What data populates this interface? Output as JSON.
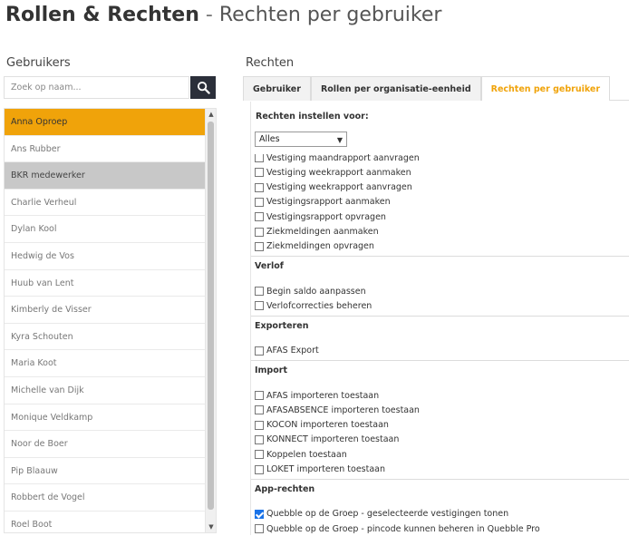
{
  "header": {
    "title_main": "Rollen & Rechten",
    "title_separator": "-",
    "title_sub": "Rechten per gebruiker"
  },
  "users": {
    "heading": "Gebruikers",
    "search_placeholder": "Zoek op naam...",
    "items": [
      {
        "name": "Anna Oproep",
        "state": "selected"
      },
      {
        "name": "Ans Rubber",
        "state": "normal"
      },
      {
        "name": "BKR medewerker",
        "state": "highlight"
      },
      {
        "name": "Charlie Verheul",
        "state": "normal"
      },
      {
        "name": "Dylan Kool",
        "state": "normal"
      },
      {
        "name": "Hedwig de Vos",
        "state": "normal"
      },
      {
        "name": "Huub van Lent",
        "state": "normal"
      },
      {
        "name": "Kimberly de Visser",
        "state": "normal"
      },
      {
        "name": "Kyra Schouten",
        "state": "normal"
      },
      {
        "name": "Maria Koot",
        "state": "normal"
      },
      {
        "name": "Michelle van Dijk",
        "state": "normal"
      },
      {
        "name": "Monique Veldkamp",
        "state": "normal"
      },
      {
        "name": "Noor de Boer",
        "state": "normal"
      },
      {
        "name": "Pip Blaauw",
        "state": "normal"
      },
      {
        "name": "Robbert de Vogel",
        "state": "normal"
      },
      {
        "name": "Roel Boot",
        "state": "normal"
      }
    ]
  },
  "rights": {
    "heading": "Rechten",
    "tabs": [
      {
        "label": "Gebruiker",
        "active": false
      },
      {
        "label": "Rollen per organisatie-eenheid",
        "active": false
      },
      {
        "label": "Rechten per gebruiker",
        "active": true
      }
    ],
    "set_for_label": "Rechten instellen voor:",
    "select_value": "Alles",
    "blocks": [
      {
        "kind": "item",
        "label": "Vestiging maandrapport aanvragen",
        "checked": false,
        "partial": true
      },
      {
        "kind": "item",
        "label": "Vestiging weekrapport aanmaken",
        "checked": false
      },
      {
        "kind": "item",
        "label": "Vestiging weekrapport aanvragen",
        "checked": false
      },
      {
        "kind": "item",
        "label": "Vestigingsrapport aanmaken",
        "checked": false
      },
      {
        "kind": "item",
        "label": "Vestigingsrapport opvragen",
        "checked": false
      },
      {
        "kind": "item",
        "label": "Ziekmeldingen aanmaken",
        "checked": false
      },
      {
        "kind": "item",
        "label": "Ziekmeldingen opvragen",
        "checked": false
      },
      {
        "kind": "section",
        "label": "Verlof"
      },
      {
        "kind": "item",
        "label": "Begin saldo aanpassen",
        "checked": false
      },
      {
        "kind": "item",
        "label": "Verlofcorrecties beheren",
        "checked": false
      },
      {
        "kind": "section",
        "label": "Exporteren"
      },
      {
        "kind": "item",
        "label": "AFAS Export",
        "checked": false
      },
      {
        "kind": "section",
        "label": "Import"
      },
      {
        "kind": "item",
        "label": "AFAS importeren toestaan",
        "checked": false
      },
      {
        "kind": "item",
        "label": "AFASABSENCE importeren toestaan",
        "checked": false
      },
      {
        "kind": "item",
        "label": "KOCON importeren toestaan",
        "checked": false
      },
      {
        "kind": "item",
        "label": "KONNECT importeren toestaan",
        "checked": false
      },
      {
        "kind": "item",
        "label": "Koppelen toestaan",
        "checked": false
      },
      {
        "kind": "item",
        "label": "LOKET importeren toestaan",
        "checked": false
      },
      {
        "kind": "section",
        "label": "App-rechten"
      },
      {
        "kind": "item",
        "label": "Quebble op de Groep - geselecteerde vestigingen tonen",
        "checked": true
      },
      {
        "kind": "item",
        "label": "Quebble op de Groep - pincode kunnen beheren in Quebble Pro",
        "checked": false
      }
    ]
  },
  "colors": {
    "accent": "#f0a30a",
    "search_button": "#2b2f3a",
    "highlight_row": "#c8c8c8",
    "checkbox_checked": "#1a73e8"
  }
}
